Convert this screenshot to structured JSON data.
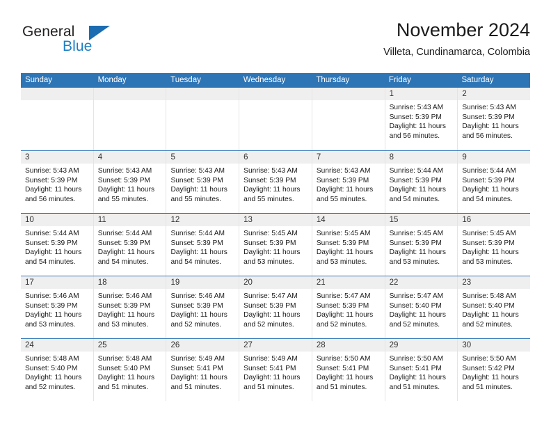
{
  "logo": {
    "word_top": "General",
    "word_bottom": "Blue",
    "triangle_color": "#1b6cb0",
    "blue_text_color": "#1f7fc4"
  },
  "header": {
    "title": "November 2024",
    "subtitle": "Villeta, Cundinamarca, Colombia"
  },
  "theme": {
    "header_blue": "#2e75b6",
    "daynum_band": "#efefef",
    "cell_border": "#e4e4e4"
  },
  "weekdays": [
    "Sunday",
    "Monday",
    "Tuesday",
    "Wednesday",
    "Thursday",
    "Friday",
    "Saturday"
  ],
  "weeks": [
    [
      {
        "day": "",
        "empty": true
      },
      {
        "day": "",
        "empty": true
      },
      {
        "day": "",
        "empty": true
      },
      {
        "day": "",
        "empty": true
      },
      {
        "day": "",
        "empty": true
      },
      {
        "day": "1",
        "sunrise": "Sunrise: 5:43 AM",
        "sunset": "Sunset: 5:39 PM",
        "daylight": "Daylight: 11 hours and 56 minutes."
      },
      {
        "day": "2",
        "sunrise": "Sunrise: 5:43 AM",
        "sunset": "Sunset: 5:39 PM",
        "daylight": "Daylight: 11 hours and 56 minutes."
      }
    ],
    [
      {
        "day": "3",
        "sunrise": "Sunrise: 5:43 AM",
        "sunset": "Sunset: 5:39 PM",
        "daylight": "Daylight: 11 hours and 56 minutes."
      },
      {
        "day": "4",
        "sunrise": "Sunrise: 5:43 AM",
        "sunset": "Sunset: 5:39 PM",
        "daylight": "Daylight: 11 hours and 55 minutes."
      },
      {
        "day": "5",
        "sunrise": "Sunrise: 5:43 AM",
        "sunset": "Sunset: 5:39 PM",
        "daylight": "Daylight: 11 hours and 55 minutes."
      },
      {
        "day": "6",
        "sunrise": "Sunrise: 5:43 AM",
        "sunset": "Sunset: 5:39 PM",
        "daylight": "Daylight: 11 hours and 55 minutes."
      },
      {
        "day": "7",
        "sunrise": "Sunrise: 5:43 AM",
        "sunset": "Sunset: 5:39 PM",
        "daylight": "Daylight: 11 hours and 55 minutes."
      },
      {
        "day": "8",
        "sunrise": "Sunrise: 5:44 AM",
        "sunset": "Sunset: 5:39 PM",
        "daylight": "Daylight: 11 hours and 54 minutes."
      },
      {
        "day": "9",
        "sunrise": "Sunrise: 5:44 AM",
        "sunset": "Sunset: 5:39 PM",
        "daylight": "Daylight: 11 hours and 54 minutes."
      }
    ],
    [
      {
        "day": "10",
        "sunrise": "Sunrise: 5:44 AM",
        "sunset": "Sunset: 5:39 PM",
        "daylight": "Daylight: 11 hours and 54 minutes."
      },
      {
        "day": "11",
        "sunrise": "Sunrise: 5:44 AM",
        "sunset": "Sunset: 5:39 PM",
        "daylight": "Daylight: 11 hours and 54 minutes."
      },
      {
        "day": "12",
        "sunrise": "Sunrise: 5:44 AM",
        "sunset": "Sunset: 5:39 PM",
        "daylight": "Daylight: 11 hours and 54 minutes."
      },
      {
        "day": "13",
        "sunrise": "Sunrise: 5:45 AM",
        "sunset": "Sunset: 5:39 PM",
        "daylight": "Daylight: 11 hours and 53 minutes."
      },
      {
        "day": "14",
        "sunrise": "Sunrise: 5:45 AM",
        "sunset": "Sunset: 5:39 PM",
        "daylight": "Daylight: 11 hours and 53 minutes."
      },
      {
        "day": "15",
        "sunrise": "Sunrise: 5:45 AM",
        "sunset": "Sunset: 5:39 PM",
        "daylight": "Daylight: 11 hours and 53 minutes."
      },
      {
        "day": "16",
        "sunrise": "Sunrise: 5:45 AM",
        "sunset": "Sunset: 5:39 PM",
        "daylight": "Daylight: 11 hours and 53 minutes."
      }
    ],
    [
      {
        "day": "17",
        "sunrise": "Sunrise: 5:46 AM",
        "sunset": "Sunset: 5:39 PM",
        "daylight": "Daylight: 11 hours and 53 minutes."
      },
      {
        "day": "18",
        "sunrise": "Sunrise: 5:46 AM",
        "sunset": "Sunset: 5:39 PM",
        "daylight": "Daylight: 11 hours and 53 minutes."
      },
      {
        "day": "19",
        "sunrise": "Sunrise: 5:46 AM",
        "sunset": "Sunset: 5:39 PM",
        "daylight": "Daylight: 11 hours and 52 minutes."
      },
      {
        "day": "20",
        "sunrise": "Sunrise: 5:47 AM",
        "sunset": "Sunset: 5:39 PM",
        "daylight": "Daylight: 11 hours and 52 minutes."
      },
      {
        "day": "21",
        "sunrise": "Sunrise: 5:47 AM",
        "sunset": "Sunset: 5:39 PM",
        "daylight": "Daylight: 11 hours and 52 minutes."
      },
      {
        "day": "22",
        "sunrise": "Sunrise: 5:47 AM",
        "sunset": "Sunset: 5:40 PM",
        "daylight": "Daylight: 11 hours and 52 minutes."
      },
      {
        "day": "23",
        "sunrise": "Sunrise: 5:48 AM",
        "sunset": "Sunset: 5:40 PM",
        "daylight": "Daylight: 11 hours and 52 minutes."
      }
    ],
    [
      {
        "day": "24",
        "sunrise": "Sunrise: 5:48 AM",
        "sunset": "Sunset: 5:40 PM",
        "daylight": "Daylight: 11 hours and 52 minutes."
      },
      {
        "day": "25",
        "sunrise": "Sunrise: 5:48 AM",
        "sunset": "Sunset: 5:40 PM",
        "daylight": "Daylight: 11 hours and 51 minutes."
      },
      {
        "day": "26",
        "sunrise": "Sunrise: 5:49 AM",
        "sunset": "Sunset: 5:41 PM",
        "daylight": "Daylight: 11 hours and 51 minutes."
      },
      {
        "day": "27",
        "sunrise": "Sunrise: 5:49 AM",
        "sunset": "Sunset: 5:41 PM",
        "daylight": "Daylight: 11 hours and 51 minutes."
      },
      {
        "day": "28",
        "sunrise": "Sunrise: 5:50 AM",
        "sunset": "Sunset: 5:41 PM",
        "daylight": "Daylight: 11 hours and 51 minutes."
      },
      {
        "day": "29",
        "sunrise": "Sunrise: 5:50 AM",
        "sunset": "Sunset: 5:41 PM",
        "daylight": "Daylight: 11 hours and 51 minutes."
      },
      {
        "day": "30",
        "sunrise": "Sunrise: 5:50 AM",
        "sunset": "Sunset: 5:42 PM",
        "daylight": "Daylight: 11 hours and 51 minutes."
      }
    ]
  ]
}
